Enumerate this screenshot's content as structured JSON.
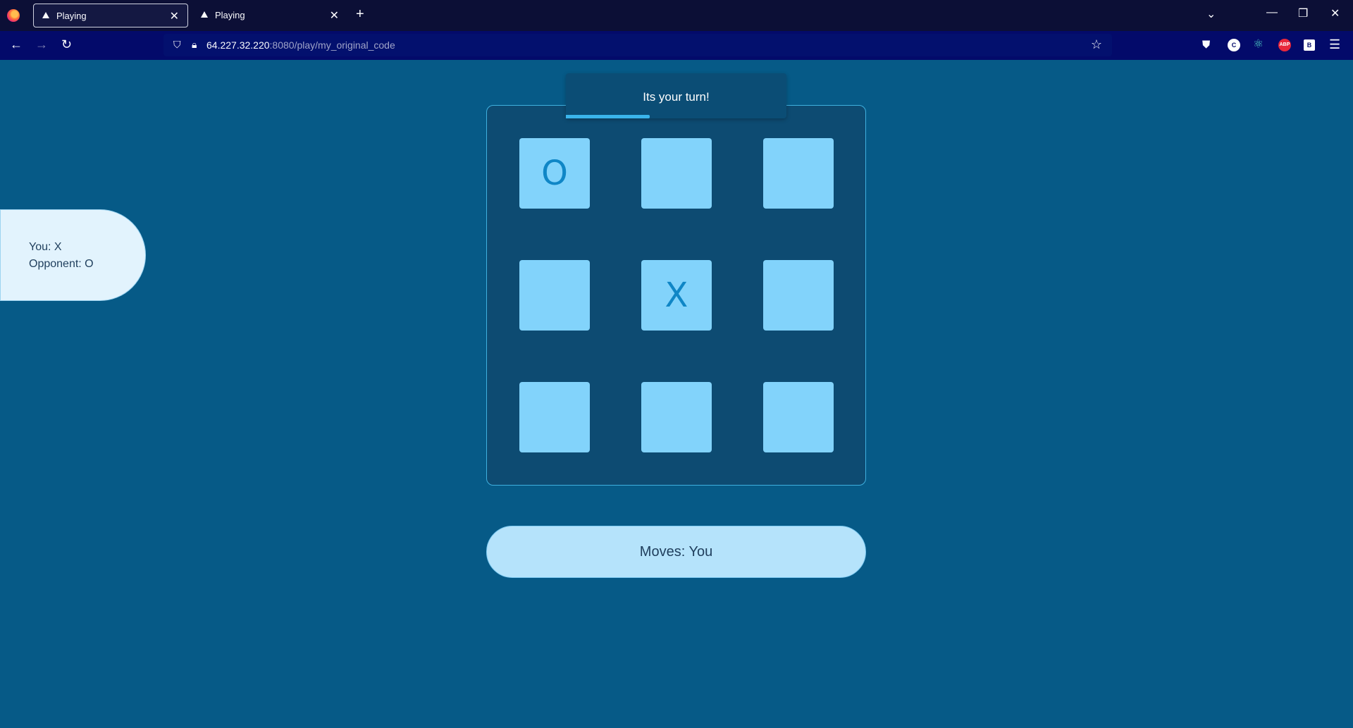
{
  "browser": {
    "tabs": [
      {
        "label": "Playing",
        "active": true
      },
      {
        "label": "Playing",
        "active": false
      }
    ],
    "url_host": "64.227.32.220",
    "url_path": ":8080/play/my_original_code",
    "extensions": [
      "pocket-icon",
      "c-icon",
      "react-icon",
      "abp-icon",
      "b-icon"
    ],
    "ext_labels": {
      "c": "C",
      "abp": "ABP",
      "b": "B"
    }
  },
  "player_info": {
    "you": "You: X",
    "opponent": "Opponent: O"
  },
  "toast": {
    "message": "Its your turn!",
    "progress": 0.38
  },
  "board": {
    "cells": [
      "O",
      "",
      "",
      "",
      "X",
      "",
      "",
      "",
      ""
    ]
  },
  "moves": {
    "text": "Moves: You"
  },
  "colors": {
    "page_bg": "#065a87",
    "board_bg": "#0d4b72",
    "cell_bg": "#82d3fb",
    "mark": "#0f86c6",
    "info_bg": "#e2f3fd",
    "moves_bg": "#b5e3fb"
  }
}
